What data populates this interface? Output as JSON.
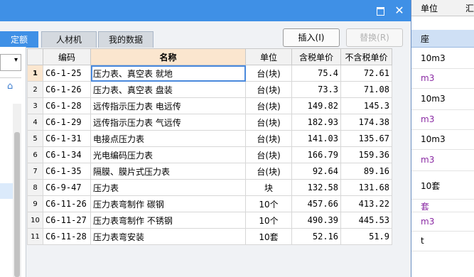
{
  "background": {
    "header": [
      "单位",
      "汇"
    ],
    "selected_text": "座",
    "rows": [
      {
        "text": "10m3",
        "purple": false
      },
      {
        "text": "m3",
        "purple": true
      },
      {
        "text": "10m3",
        "purple": false
      },
      {
        "text": "m3",
        "purple": true
      },
      {
        "text": "10m3",
        "purple": false
      },
      {
        "text": "m3",
        "purple": true
      },
      {
        "text": "10套",
        "purple": false
      },
      {
        "text": "套",
        "purple": true
      },
      {
        "text": "m3",
        "purple": true
      },
      {
        "text": "t",
        "purple": false
      }
    ]
  },
  "titlebar": {
    "maximize_icon": "maximize-icon",
    "close_icon": "close-icon",
    "close_glyph": "✕"
  },
  "tabs": [
    "定额",
    "人材机",
    "我的数据"
  ],
  "buttons": {
    "insert": "插入(I)",
    "replace": "替换(R)"
  },
  "left_panel": {
    "dropdown_glyph": "▾",
    "tool_icon": "house-icon",
    "tool_glyph": "⌂"
  },
  "table": {
    "columns": [
      "编码",
      "名称",
      "单位",
      "含税单价",
      "不含税单价"
    ],
    "rows": [
      {
        "n": "1",
        "code": "C6-1-25",
        "name": "压力表、真空表 就地",
        "unit": "台(块)",
        "tax": "75.4",
        "notax": "72.61"
      },
      {
        "n": "2",
        "code": "C6-1-26",
        "name": "压力表、真空表 盘装",
        "unit": "台(块)",
        "tax": "73.3",
        "notax": "71.08"
      },
      {
        "n": "3",
        "code": "C6-1-28",
        "name": "远传指示压力表 电远传",
        "unit": "台(块)",
        "tax": "149.82",
        "notax": "145.3"
      },
      {
        "n": "4",
        "code": "C6-1-29",
        "name": "远传指示压力表 气远传",
        "unit": "台(块)",
        "tax": "182.93",
        "notax": "174.38"
      },
      {
        "n": "5",
        "code": "C6-1-31",
        "name": "电接点压力表",
        "unit": "台(块)",
        "tax": "141.03",
        "notax": "135.67"
      },
      {
        "n": "6",
        "code": "C6-1-34",
        "name": "光电编码压力表",
        "unit": "台(块)",
        "tax": "166.79",
        "notax": "159.36"
      },
      {
        "n": "7",
        "code": "C6-1-35",
        "name": "隔膜、膜片式压力表",
        "unit": "台(块)",
        "tax": "92.64",
        "notax": "89.16"
      },
      {
        "n": "8",
        "code": "C6-9-47",
        "name": "压力表",
        "unit": "块",
        "tax": "132.58",
        "notax": "131.68"
      },
      {
        "n": "9",
        "code": "C6-11-26",
        "name": "压力表弯制作 碳钢",
        "unit": "10个",
        "tax": "457.66",
        "notax": "413.22"
      },
      {
        "n": "10",
        "code": "C6-11-27",
        "name": "压力表弯制作 不锈钢",
        "unit": "10个",
        "tax": "490.39",
        "notax": "445.53"
      },
      {
        "n": "11",
        "code": "C6-11-28",
        "name": "压力表弯安装",
        "unit": "10套",
        "tax": "52.16",
        "notax": "51.9"
      }
    ]
  }
}
